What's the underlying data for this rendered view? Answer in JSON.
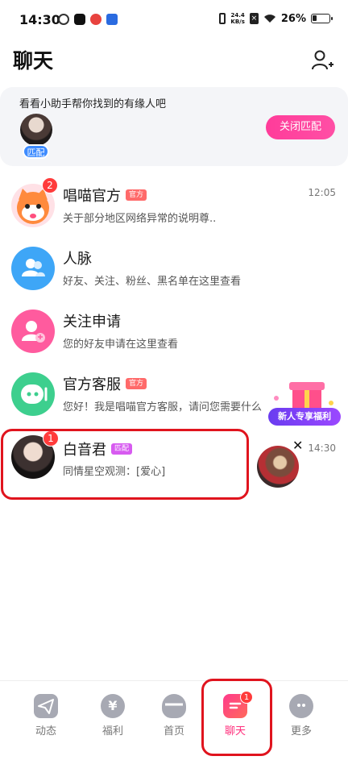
{
  "status_bar": {
    "time": "14:30",
    "net_speed_value": "24.4",
    "net_speed_unit": "KB/s",
    "battery_percent": "26%"
  },
  "header": {
    "title": "聊天"
  },
  "match_card": {
    "prompt": "看看小助手帮你找到的有缘人吧",
    "badge": "匹配",
    "close_button": "关闭匹配"
  },
  "chats": [
    {
      "name": "唱喵官方",
      "tag": "官方",
      "preview": "关于部分地区网络异常的说明尊..",
      "time": "12:05",
      "unread": "2"
    },
    {
      "name": "人脉",
      "tag": "",
      "preview": "好友、关注、粉丝、黑名单在这里查看",
      "time": "",
      "unread": ""
    },
    {
      "name": "关注申请",
      "tag": "",
      "preview": "您的好友申请在这里查看",
      "time": "",
      "unread": ""
    },
    {
      "name": "官方客服",
      "tag": "官方",
      "preview": "您好！我是唱喵官方客服，请问您需要什么",
      "time": "",
      "unread": ""
    },
    {
      "name": "白音君",
      "tag": "匹配",
      "preview": "同情星空观测：[爱心]",
      "time": "14:30",
      "unread": "1"
    }
  ],
  "promo": {
    "label": "新人专享福利",
    "close": "✕"
  },
  "bottom_nav": [
    {
      "label": "动态",
      "icon": "paper-plane-icon"
    },
    {
      "label": "福利",
      "icon": "yen-coin-icon",
      "glyph": "¥"
    },
    {
      "label": "首页",
      "icon": "home-cat-icon"
    },
    {
      "label": "聊天",
      "icon": "chat-icon",
      "badge": "1",
      "active": true
    },
    {
      "label": "更多",
      "icon": "more-icon"
    }
  ],
  "colors": {
    "accent_pink": "#ff3c9a",
    "badge_red": "#ff3b3b",
    "match_blue": "#3d8bff",
    "highlight_red": "#e0141e"
  }
}
